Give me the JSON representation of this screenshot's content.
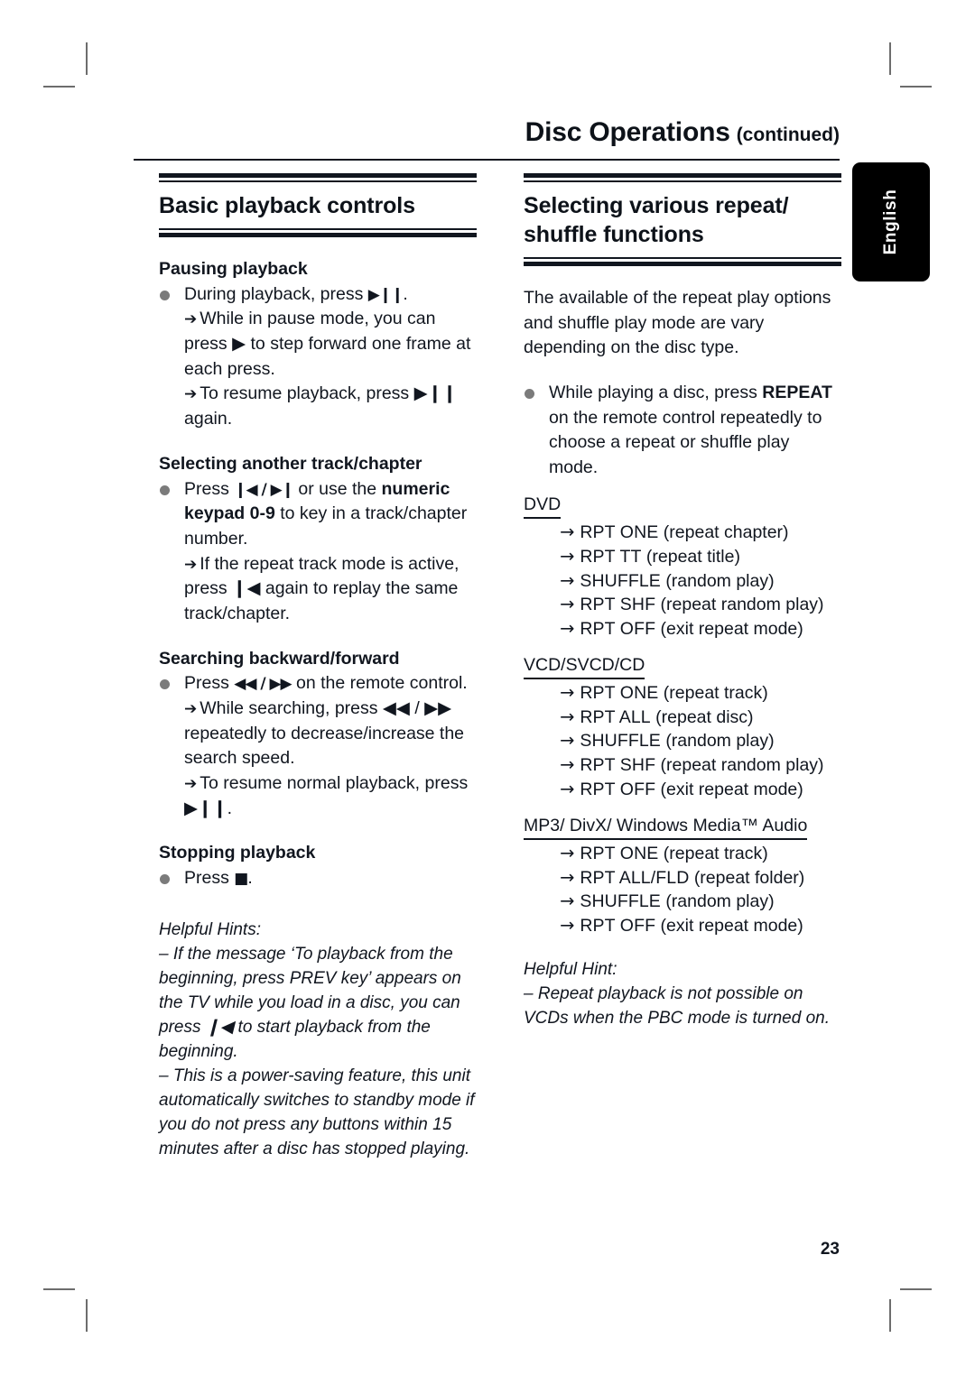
{
  "crop_marks": true,
  "runhead": {
    "title": "Disc Operations",
    "continued": "(continued)"
  },
  "language_tab": {
    "label": "English"
  },
  "folio": {
    "page_number": "23"
  },
  "left_column": {
    "section_title": "Basic playback controls",
    "blocks": [
      {
        "subhead": "Pausing playback",
        "bullet_lead": "During playback, press ",
        "bullet_glyph": "▶❙❙",
        "bullet_tail": ".",
        "arrows": [
          "While in pause mode, you can press ▶ to step forward one frame at each press.",
          "To resume playback, press ▶❙❙ again."
        ]
      },
      {
        "subhead": "Selecting another track/chapter",
        "bullet_lead": "Press ",
        "bullet_glyph": "❙◀ / ▶❙",
        "bullet_mid": " or use the ",
        "bullet_strong": "numeric keypad 0-9",
        "bullet_tail": " to key in a track/chapter number.",
        "arrows": [
          "If the repeat track mode is active, press ❙◀ again to replay the same track/chapter."
        ]
      },
      {
        "subhead": "Searching backward/forward",
        "bullet_lead": "Press ",
        "bullet_glyph": "◀◀ / ▶▶",
        "bullet_tail": " on the remote control.",
        "arrows": [
          "While searching, press ◀◀ / ▶▶ repeatedly to decrease/increase the search speed.",
          "To resume normal playback, press ▶❙❙."
        ]
      },
      {
        "subhead": "Stopping playback",
        "bullet_lead": "Press ",
        "bullet_glyph": "■",
        "bullet_tail": "."
      }
    ],
    "hints_title": "Helpful Hints:",
    "hints": [
      "– If the message ‘To playback from the beginning, press PREV key’ appears on the TV while you load in a disc, you can press ❙◀ to start playback from the beginning.",
      "– This is a power-saving feature, this unit automatically switches to standby mode if you do not press any buttons within 15 minutes after a disc has stopped playing."
    ]
  },
  "right_column": {
    "section_title": "Selecting various repeat/ shuffle functions",
    "intro": "The available of the repeat play options and shuffle play mode are vary depending on the disc type.",
    "bullet": {
      "lead": "While playing a disc, press ",
      "strong": "REPEAT",
      "tail": " on the remote control repeatedly to choose a repeat or shuffle play mode."
    },
    "mode_groups": [
      {
        "heading": "DVD",
        "items": [
          {
            "code": "RPT ONE",
            "desc": "(repeat chapter)"
          },
          {
            "code": "RPT TT",
            "desc": "(repeat title)"
          },
          {
            "code": "SHUFFLE",
            "desc": "(random play)"
          },
          {
            "code": "RPT SHF",
            "desc": "(repeat random play)"
          },
          {
            "code": "RPT OFF",
            "desc": "(exit repeat mode)"
          }
        ]
      },
      {
        "heading": "VCD/SVCD/CD",
        "items": [
          {
            "code": "RPT ONE",
            "desc": "(repeat track)"
          },
          {
            "code": "RPT ALL",
            "desc": "(repeat disc)"
          },
          {
            "code": "SHUFFLE",
            "desc": "(random play)"
          },
          {
            "code": "RPT SHF",
            "desc": "(repeat random play)"
          },
          {
            "code": "RPT OFF",
            "desc": "(exit repeat mode)"
          }
        ]
      },
      {
        "heading": "MP3/ DivX/ Windows Media™ Audio",
        "items": [
          {
            "code": "RPT ONE",
            "desc": "(repeat track)"
          },
          {
            "code": "RPT ALL/FLD",
            "desc": "(repeat folder)"
          },
          {
            "code": "SHUFFLE",
            "desc": "(random play)"
          },
          {
            "code": "RPT OFF",
            "desc": "(exit repeat mode)"
          }
        ]
      }
    ],
    "hint_title": "Helpful Hint:",
    "hint": "– Repeat playback is not possible on VCDs when the PBC mode is turned on.",
    "arrow_glyph": "→"
  }
}
